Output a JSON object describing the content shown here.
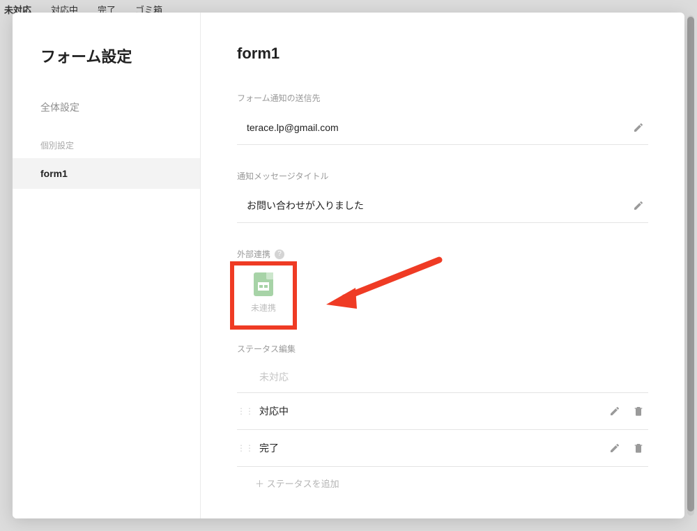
{
  "backdrop_tabs": [
    {
      "label": "未対応",
      "active": true
    },
    {
      "label": "対応中",
      "active": false
    },
    {
      "label": "完了",
      "active": false
    },
    {
      "label": "ゴミ箱",
      "active": false
    }
  ],
  "sidebar": {
    "title": "フォーム設定",
    "global_label": "全体設定",
    "individual_section": "個別設定",
    "items": [
      {
        "label": "form1",
        "active": true
      }
    ]
  },
  "content": {
    "title": "form1",
    "notify_dest_label": "フォーム通知の送信先",
    "notify_dest_value": "terace.lp@gmail.com",
    "notify_title_label": "通知メッセージタイトル",
    "notify_title_value": "お問い合わせが入りました",
    "integration_label": "外部連携",
    "integration_status": "未連携",
    "status_edit_label": "ステータス編集",
    "status_placeholder": "未対応",
    "statuses": [
      {
        "label": "対応中"
      },
      {
        "label": "完了"
      }
    ],
    "add_status_label": "＋ ステータスを追加"
  },
  "annotation": {
    "highlight_color": "#ef3b24"
  }
}
